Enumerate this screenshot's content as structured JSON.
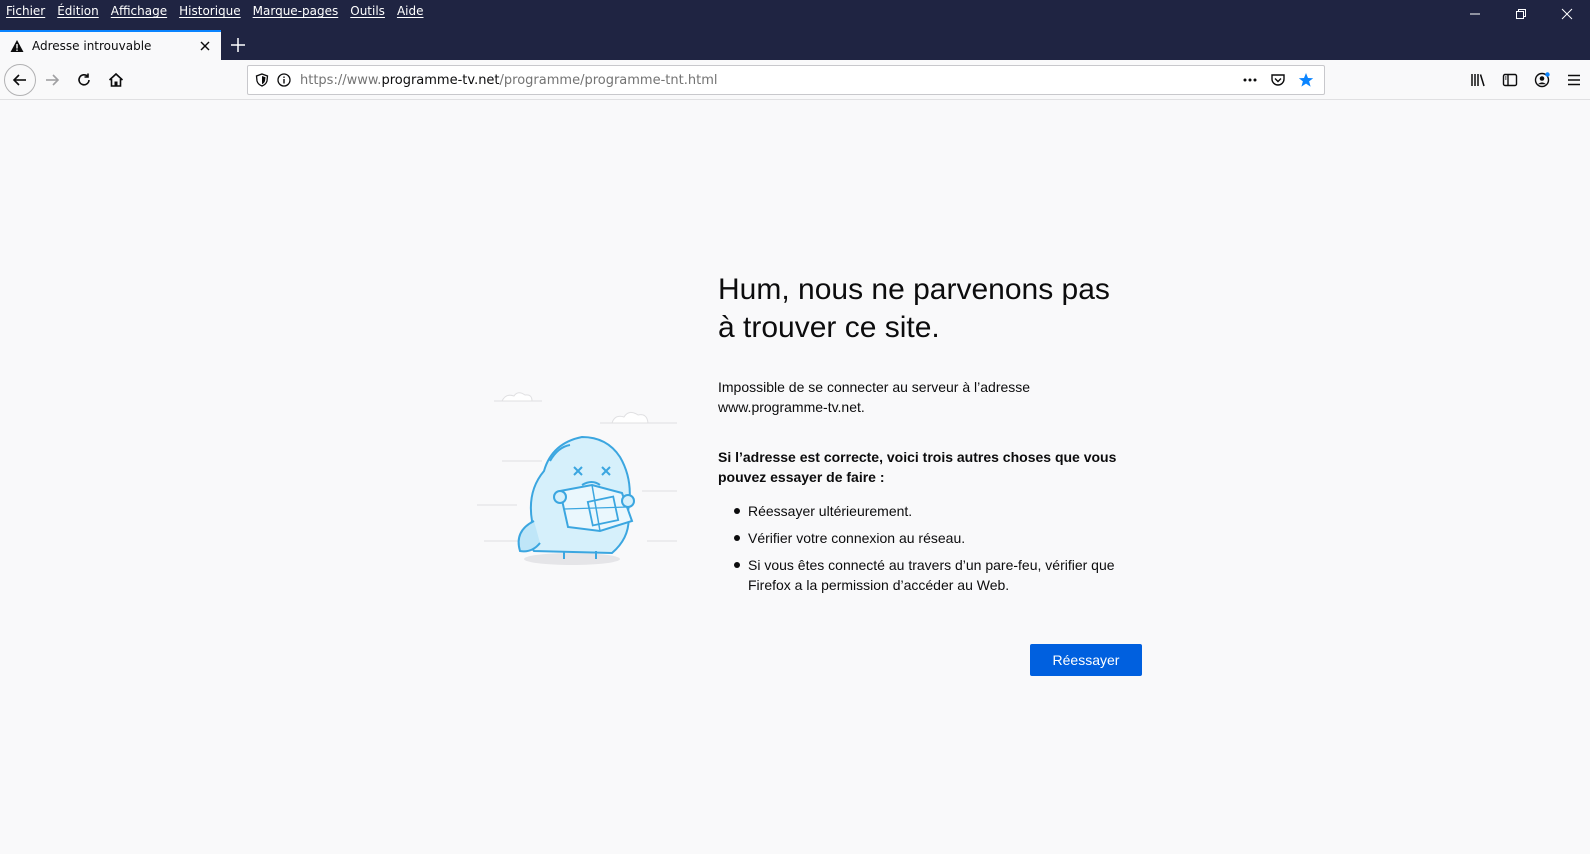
{
  "menu": [
    "Fichier",
    "Édition",
    "Affichage",
    "Historique",
    "Marque-pages",
    "Outils",
    "Aide"
  ],
  "tab": {
    "title": "Adresse introuvable"
  },
  "url": {
    "scheme": "https://www.",
    "host": "programme-tv.net",
    "path": "/programme/programme-tnt.html"
  },
  "error": {
    "title_line1": "Hum, nous ne parvenons pas",
    "title_line2": "à trouver ce site.",
    "desc_line1": "Impossible de se connecter au serveur à l’adresse",
    "desc_line2": "www.programme-tv.net.",
    "sub_line1": "Si l’adresse est correcte, voici trois autres choses que vous",
    "sub_line2": "pouvez essayer de faire :",
    "items": [
      "Réessayer ultérieurement.",
      "Vérifier votre connexion au réseau.",
      "Si vous êtes connecté au travers d’un pare-feu, vérifier que Firefox a la permission d’accéder au Web."
    ],
    "retry_label": "Réessayer"
  },
  "colors": {
    "titlebar": "#1f2442",
    "accent": "#0a84ff",
    "button": "#0060df",
    "star": "#0a84ff"
  }
}
